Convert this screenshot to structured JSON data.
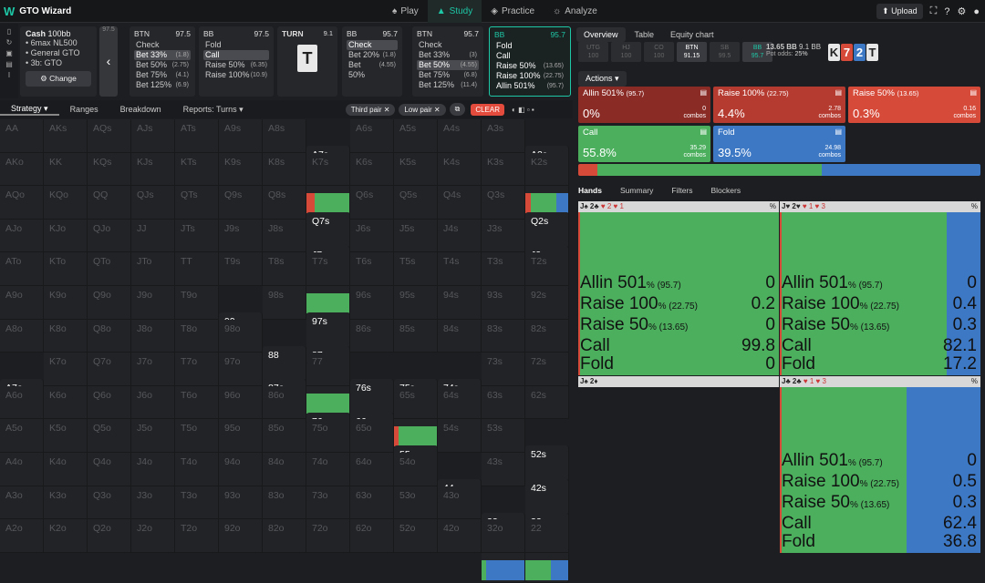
{
  "app": {
    "logo": "W",
    "title": "GTO Wizard"
  },
  "nav": [
    {
      "label": "Play",
      "icon": "spade-icon"
    },
    {
      "label": "Study",
      "icon": "grad-cap-icon"
    },
    {
      "label": "Practice",
      "icon": "gamepad-icon"
    },
    {
      "label": "Analyze",
      "icon": "bulb-icon"
    }
  ],
  "upload": "Upload",
  "spot": {
    "title": "Cash",
    "stake": "100bb",
    "items": [
      "6max NL500",
      "General GTO",
      "3b: GTO"
    ],
    "change": "Change",
    "scroll": "97.5"
  },
  "actions_strip": [
    {
      "pos": "BTN",
      "stack": "97.5",
      "rows": [
        {
          "l": "Check",
          "v": ""
        },
        {
          "l": "Bet 33%",
          "v": "(1.8)",
          "sel": true
        },
        {
          "l": "Bet 50%",
          "v": "(2.75)"
        },
        {
          "l": "Bet 75%",
          "v": "(4.1)"
        },
        {
          "l": "Bet 125%",
          "v": "(6.9)"
        }
      ]
    },
    {
      "pos": "BB",
      "stack": "97.5",
      "rows": [
        {
          "l": "Fold",
          "v": ""
        },
        {
          "l": "Call",
          "v": "",
          "sel": true
        },
        {
          "l": "Raise 50%",
          "v": "(6.35)"
        },
        {
          "l": "Raise 100%",
          "v": "(10.9)"
        }
      ]
    },
    {
      "pos": "BB",
      "stack": "95.7",
      "rows": [
        {
          "l": "Check",
          "v": "",
          "sel": true
        },
        {
          "l": "Bet 20%",
          "v": "(1.8)"
        },
        {
          "l": "Bet 50%",
          "v": "(4.55)"
        }
      ]
    },
    {
      "pos": "BTN",
      "stack": "95.7",
      "rows": [
        {
          "l": "Check",
          "v": ""
        },
        {
          "l": "Bet 33%",
          "v": "(3)"
        },
        {
          "l": "Bet 50%",
          "v": "(4.55)",
          "sel": true
        },
        {
          "l": "Bet 75%",
          "v": "(6.8)"
        },
        {
          "l": "Bet 125%",
          "v": "(11.4)"
        }
      ]
    },
    {
      "pos": "BB",
      "stack": "95.7",
      "rows": [
        {
          "l": "Fold",
          "v": ""
        },
        {
          "l": "Call",
          "v": ""
        },
        {
          "l": "Raise 50%",
          "v": "(13.65)"
        },
        {
          "l": "Raise 100%",
          "v": "(22.75)"
        },
        {
          "l": "Allin 501%",
          "v": "(95.7)"
        }
      ]
    }
  ],
  "turn": {
    "label": "TURN",
    "value": "9.1",
    "card": "T"
  },
  "toolbar": {
    "tabs": [
      "Strategy",
      "Ranges",
      "Breakdown",
      "Reports: Turns"
    ],
    "chips": [
      "Third pair",
      "Low pair"
    ],
    "clear": "CLEAR"
  },
  "grid_labels": [
    [
      "AA",
      "AKs",
      "AQs",
      "AJs",
      "ATs",
      "A9s",
      "A8s",
      "A7s",
      "A6s",
      "A5s",
      "A4s",
      "A3s",
      "A2s"
    ],
    [
      "AKo",
      "KK",
      "KQs",
      "KJs",
      "KTs",
      "K9s",
      "K8s",
      "K7s",
      "K6s",
      "K5s",
      "K4s",
      "K3s",
      "K2s"
    ],
    [
      "AQo",
      "KQo",
      "QQ",
      "QJs",
      "QTs",
      "Q9s",
      "Q8s",
      "Q7s",
      "Q6s",
      "Q5s",
      "Q4s",
      "Q3s",
      "Q2s"
    ],
    [
      "AJo",
      "KJo",
      "QJo",
      "JJ",
      "JTs",
      "J9s",
      "J8s",
      "J7s",
      "J6s",
      "J5s",
      "J4s",
      "J3s",
      "J2s"
    ],
    [
      "ATo",
      "KTo",
      "QTo",
      "JTo",
      "TT",
      "T9s",
      "T8s",
      "T7s",
      "T6s",
      "T5s",
      "T4s",
      "T3s",
      "T2s"
    ],
    [
      "A9o",
      "K9o",
      "Q9o",
      "J9o",
      "T9o",
      "99",
      "98s",
      "97s",
      "96s",
      "95s",
      "94s",
      "93s",
      "92s"
    ],
    [
      "A8o",
      "K8o",
      "Q8o",
      "J8o",
      "T8o",
      "98o",
      "88",
      "87s",
      "86s",
      "85s",
      "84s",
      "83s",
      "82s"
    ],
    [
      "A7o",
      "K7o",
      "Q7o",
      "J7o",
      "T7o",
      "97o",
      "87o",
      "77",
      "76s",
      "75s",
      "74s",
      "73s",
      "72s"
    ],
    [
      "A6o",
      "K6o",
      "Q6o",
      "J6o",
      "T6o",
      "96o",
      "86o",
      "76o",
      "66",
      "65s",
      "64s",
      "63s",
      "62s"
    ],
    [
      "A5o",
      "K5o",
      "Q5o",
      "J5o",
      "T5o",
      "95o",
      "85o",
      "75o",
      "65o",
      "55",
      "54s",
      "53s",
      "52s"
    ],
    [
      "A4o",
      "K4o",
      "Q4o",
      "J4o",
      "T4o",
      "94o",
      "84o",
      "74o",
      "64o",
      "54o",
      "44",
      "43s",
      "42s"
    ],
    [
      "A3o",
      "K3o",
      "Q3o",
      "J3o",
      "T3o",
      "93o",
      "83o",
      "73o",
      "63o",
      "53o",
      "43o",
      "33",
      "32s"
    ],
    [
      "A2o",
      "K2o",
      "Q2o",
      "J2o",
      "T2o",
      "92o",
      "82o",
      "72o",
      "62o",
      "52o",
      "42o",
      "32o",
      "22"
    ]
  ],
  "right": {
    "tabs": [
      "Overview",
      "Table",
      "Equity chart"
    ],
    "positions": [
      {
        "p": "UTG",
        "s": "100"
      },
      {
        "p": "HJ",
        "s": "100"
      },
      {
        "p": "CO",
        "s": "100"
      },
      {
        "p": "BTN",
        "s": "91.15"
      },
      {
        "p": "SB",
        "s": "99.5"
      },
      {
        "p": "BB",
        "s": "95.7"
      }
    ],
    "pot": "13.65 BB",
    "pot2": "9.1 BB",
    "potodds_l": "Pot odds:",
    "potodds": "25%",
    "board": [
      {
        "r": "K",
        "c": "#e8e8e8",
        "t": "#222"
      },
      {
        "r": "7",
        "c": "#d64a3a",
        "t": "#fff"
      },
      {
        "r": "2",
        "c": "#3d78c5",
        "t": "#fff"
      },
      {
        "r": "T",
        "c": "#e8e8e8",
        "t": "#222"
      }
    ],
    "actions_btn": "Actions",
    "boxes": [
      {
        "n": "Allin 501%",
        "s": "(95.7)",
        "p": "0%",
        "c": "0",
        "cl": "combos",
        "col": "#8a2b26"
      },
      {
        "n": "Raise 100%",
        "s": "(22.75)",
        "p": "4.4%",
        "c": "2.78",
        "cl": "combos",
        "col": "#b53a2f"
      },
      {
        "n": "Raise 50%",
        "s": "(13.65)",
        "p": "0.3%",
        "c": "0.16",
        "cl": "combos",
        "col": "#d64a3a"
      },
      {
        "n": "Call",
        "s": "",
        "p": "55.8%",
        "c": "35.29",
        "cl": "combos",
        "col": "#4caf5e"
      },
      {
        "n": "Fold",
        "s": "",
        "p": "39.5%",
        "c": "24.98",
        "cl": "combos",
        "col": "#3d78c5"
      }
    ],
    "subtabs": [
      "Hands",
      "Summary",
      "Filters",
      "Blockers"
    ],
    "hands": [
      {
        "name": "J♠ 2♣",
        "tags": "♥ 2 ♥ 1",
        "pct": "%",
        "fold_frac": 0,
        "lines": [
          {
            "l": "Allin 501",
            "s": "(95.7)",
            "v": "0"
          },
          {
            "l": "Raise 100",
            "s": "(22.75)",
            "v": "0.2"
          },
          {
            "l": "Raise 50",
            "s": "(13.65)",
            "v": "0"
          },
          {
            "l": "Call",
            "s": "",
            "v": "99.8"
          },
          {
            "l": "Fold",
            "s": "",
            "v": "0"
          }
        ]
      },
      {
        "name": "J♥ 2♥",
        "tags": "♥ 1 ♥ 3",
        "pct": "%",
        "fold_frac": 0.17,
        "lines": [
          {
            "l": "Allin 501",
            "s": "(95.7)",
            "v": "0"
          },
          {
            "l": "Raise 100",
            "s": "(22.75)",
            "v": "0.4"
          },
          {
            "l": "Raise 50",
            "s": "(13.65)",
            "v": "0.3"
          },
          {
            "l": "Call",
            "s": "",
            "v": "82.1"
          },
          {
            "l": "Fold",
            "s": "",
            "v": "17.2"
          }
        ]
      },
      {
        "name": "J♠ 2♦",
        "tags": "",
        "pct": "",
        "fold_frac": 0,
        "lines": []
      },
      {
        "name": "J♣ 2♣",
        "tags": "♥ 1 ♥ 3",
        "pct": "%",
        "fold_frac": 0.37,
        "lines": [
          {
            "l": "Allin 501",
            "s": "(95.7)",
            "v": "0"
          },
          {
            "l": "Raise 100",
            "s": "(22.75)",
            "v": "0.5"
          },
          {
            "l": "Raise 50",
            "s": "(13.65)",
            "v": "0.3"
          },
          {
            "l": "Call",
            "s": "",
            "v": "62.4"
          },
          {
            "l": "Fold",
            "s": "",
            "v": "36.8"
          }
        ]
      }
    ]
  },
  "active_cells": {
    "A7s": [
      0.2,
      0.8,
      0
    ],
    "A2s": [
      0.12,
      0.6,
      0.28
    ],
    "Q7s": [
      0,
      1,
      0
    ],
    "Q2s": [
      0,
      0.7,
      0.3
    ],
    "J7s": [
      0,
      1,
      0
    ],
    "J2s": [
      0,
      0.6,
      0.4
    ],
    "99": [
      0,
      1,
      0
    ],
    "97s": [
      0,
      1,
      0
    ],
    "88": [
      0,
      0.78,
      0.22
    ],
    "87s": [
      0,
      1,
      0
    ],
    "A7o": [
      0.12,
      0.88,
      0
    ],
    "87o": [
      0,
      1,
      0
    ],
    "76s": [
      0,
      1,
      0
    ],
    "75s": [
      0.1,
      0.9,
      0
    ],
    "74s": [
      0.15,
      0.85,
      0
    ],
    "76o": [
      0,
      1,
      0
    ],
    "66": [
      0,
      0.1,
      0.9
    ],
    "55": [
      0,
      0.05,
      0.95
    ],
    "52s": [
      0.05,
      0.95,
      0
    ],
    "44": [
      0,
      0.05,
      0.95
    ],
    "42s": [
      0,
      1,
      0
    ],
    "33": [
      0,
      0.1,
      0.9
    ],
    "32s": [
      0,
      0.6,
      0.4
    ]
  }
}
